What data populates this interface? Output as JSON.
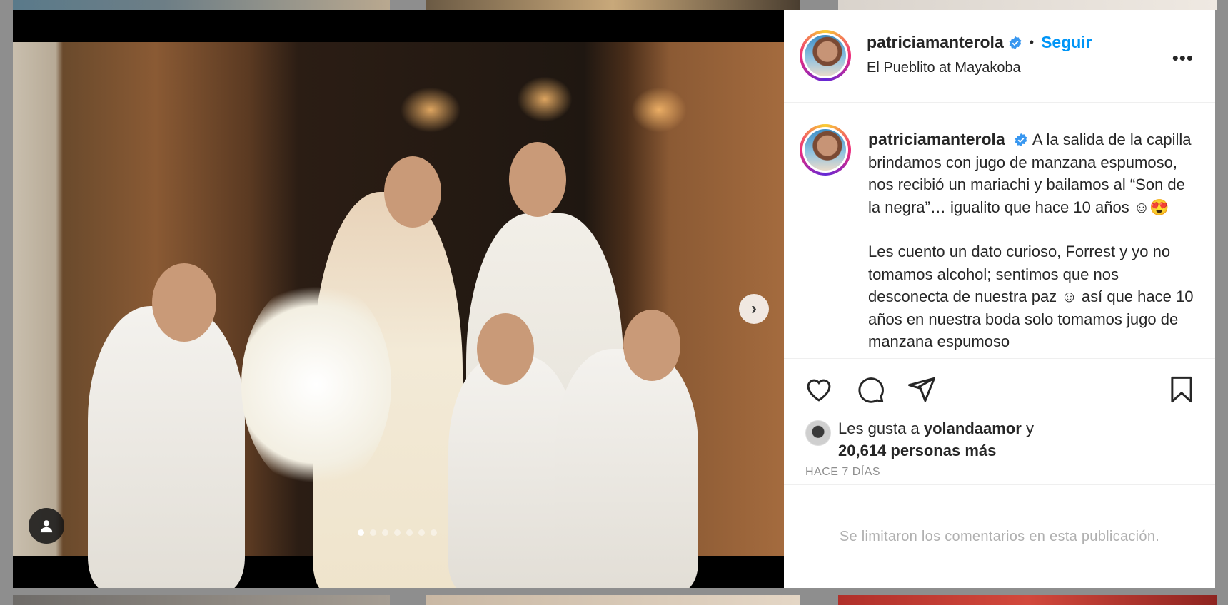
{
  "post": {
    "username": "patriciamanterola",
    "follow_label": "Seguir",
    "separator": "•",
    "location": "El Pueblito at Mayakoba",
    "more_label": "•••"
  },
  "caption": {
    "username": "patriciamanterola",
    "paragraph1": "A la salida de la capilla brindamos con jugo de manzana espumoso, nos recibió un mariachi y bailamos al “Son de la negra”… igualito que hace 10 años ☺😍",
    "paragraph2": "Les cuento un dato curioso, Forrest y yo no tomamos alcohol; sentimos que nos desconecta de nuestra paz ☺ así que hace 10 años en nuestra boda solo tomamos jugo de manzana espumoso"
  },
  "likes": {
    "prefix": "Les gusta a",
    "liker": "yolandaamor",
    "connector": "y",
    "others": "20,614 personas más"
  },
  "timestamp": "HACE 7 DÍAS",
  "comments_notice": "Se limitaron los comentarios en esta publicación.",
  "carousel": {
    "next_label": "›",
    "slide_count": 7,
    "active_index": 0
  },
  "icons": [
    "heart-icon",
    "comment-icon",
    "share-icon",
    "bookmark-icon",
    "user-tag-icon",
    "verified-icon",
    "chevron-right-icon",
    "more-icon"
  ],
  "colors": {
    "follow": "#0095f6",
    "verified": "#3897f0",
    "text": "#262626",
    "muted": "#8e8e8e"
  }
}
